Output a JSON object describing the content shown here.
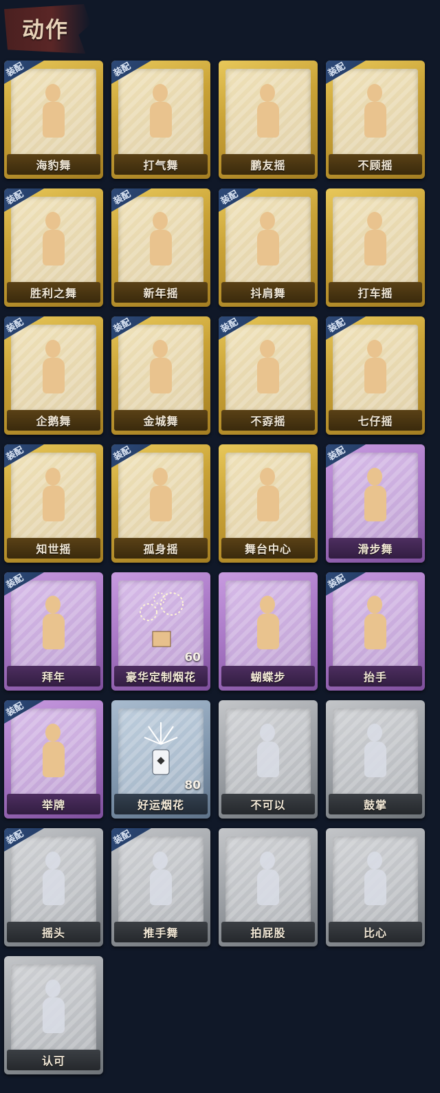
{
  "section_title": "动作",
  "badge_label": "装配",
  "items": [
    {
      "name": "海豹舞",
      "tier": "gold",
      "equipped": true
    },
    {
      "name": "打气舞",
      "tier": "gold",
      "equipped": true
    },
    {
      "name": "鹏友摇",
      "tier": "gold",
      "equipped": false
    },
    {
      "name": "不顾摇",
      "tier": "gold",
      "equipped": true
    },
    {
      "name": "胜利之舞",
      "tier": "gold",
      "equipped": true
    },
    {
      "name": "新年摇",
      "tier": "gold",
      "equipped": true
    },
    {
      "name": "抖肩舞",
      "tier": "gold",
      "equipped": true
    },
    {
      "name": "打车摇",
      "tier": "gold",
      "equipped": false
    },
    {
      "name": "企鹅舞",
      "tier": "gold",
      "equipped": true
    },
    {
      "name": "金城舞",
      "tier": "gold",
      "equipped": true
    },
    {
      "name": "不孬摇",
      "tier": "gold",
      "equipped": true
    },
    {
      "name": "七仔摇",
      "tier": "gold",
      "equipped": true
    },
    {
      "name": "知世摇",
      "tier": "gold",
      "equipped": true
    },
    {
      "name": "孤身摇",
      "tier": "gold",
      "equipped": true
    },
    {
      "name": "舞台中心",
      "tier": "gold",
      "equipped": false
    },
    {
      "name": "滑步舞",
      "tier": "purple",
      "equipped": true
    },
    {
      "name": "拜年",
      "tier": "purple",
      "equipped": true
    },
    {
      "name": "豪华定制烟花",
      "tier": "purple",
      "equipped": false,
      "count": "60",
      "icon": "fireworks-box-icon"
    },
    {
      "name": "蝴蝶步",
      "tier": "purple",
      "equipped": false
    },
    {
      "name": "抬手",
      "tier": "purple",
      "equipped": true
    },
    {
      "name": "举牌",
      "tier": "purple",
      "equipped": true
    },
    {
      "name": "好运烟花",
      "tier": "blue",
      "equipped": false,
      "count": "80",
      "icon": "firework-canister-icon"
    },
    {
      "name": "不可以",
      "tier": "gray",
      "equipped": false
    },
    {
      "name": "鼓掌",
      "tier": "gray",
      "equipped": false
    },
    {
      "name": "摇头",
      "tier": "gray",
      "equipped": true
    },
    {
      "name": "推手舞",
      "tier": "gray",
      "equipped": true
    },
    {
      "name": "拍屁股",
      "tier": "gray",
      "equipped": false
    },
    {
      "name": "比心",
      "tier": "gray",
      "equipped": false
    },
    {
      "name": "认可",
      "tier": "gray",
      "equipped": false
    }
  ]
}
